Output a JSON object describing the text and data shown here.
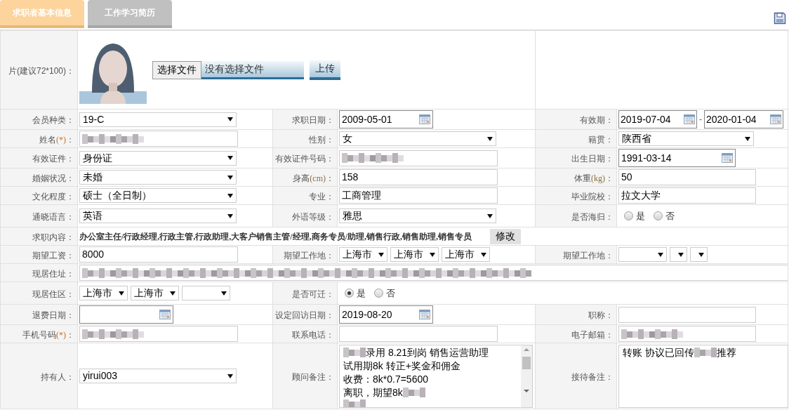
{
  "tabs": [
    {
      "label": "求职者基本信息",
      "selected": true
    },
    {
      "label": "工作学习简历",
      "selected": false
    }
  ],
  "photo_row": {
    "label": "片(建议72*100)：",
    "file_button": "选择文件",
    "file_status": "没有选择文件",
    "upload_button": "上传"
  },
  "rows": [
    {
      "cells": [
        {
          "label": "会员种类：",
          "field": {
            "kind": "select",
            "value": "19-C"
          }
        },
        {
          "label": "求职日期：",
          "field": {
            "kind": "date",
            "value": "2009-05-01"
          }
        },
        {
          "label": "有效期：",
          "field": {
            "kind": "date_range",
            "from": "2019-07-04",
            "separator": "-",
            "to": "2020-01-04"
          }
        }
      ]
    },
    {
      "cells": [
        {
          "label": "姓名",
          "mark": "(*)",
          "suffix": "：",
          "field": {
            "kind": "input",
            "blurred": true
          }
        },
        {
          "label": "性别：",
          "field": {
            "kind": "select",
            "value": "女"
          }
        },
        {
          "label": "籍贯：",
          "field": {
            "kind": "select",
            "value": "陕西省"
          }
        }
      ]
    },
    {
      "cells": [
        {
          "label": "有效证件：",
          "field": {
            "kind": "select",
            "value": "身份证"
          }
        },
        {
          "label": "有效证件号码：",
          "field": {
            "kind": "input",
            "blurred": true
          }
        },
        {
          "label": "出生日期：",
          "field": {
            "kind": "date",
            "value": "1991-03-14"
          }
        }
      ]
    },
    {
      "cells": [
        {
          "label": "婚姻状况：",
          "field": {
            "kind": "select",
            "value": "未婚"
          }
        },
        {
          "label": "身高",
          "unit": "(cm)",
          "suffix": "：",
          "field": {
            "kind": "input",
            "value": "158"
          }
        },
        {
          "label": "体重",
          "unit": "(kg)",
          "suffix": "：",
          "field": {
            "kind": "input",
            "value": "50"
          }
        }
      ]
    },
    {
      "cells": [
        {
          "label": "文化程度：",
          "field": {
            "kind": "select",
            "value": "硕士（全日制）"
          }
        },
        {
          "label": "专业：",
          "field": {
            "kind": "input",
            "value": "工商管理"
          }
        },
        {
          "label": "毕业院校：",
          "field": {
            "kind": "input",
            "value": "拉文大学"
          }
        }
      ]
    },
    {
      "cells": [
        {
          "label": "通晓语言：",
          "field": {
            "kind": "select",
            "value": "英语"
          }
        },
        {
          "label": "外语等级：",
          "field": {
            "kind": "select",
            "value": "雅思"
          }
        },
        {
          "label": "是否海归：",
          "field": {
            "kind": "radios",
            "options": [
              {
                "label": "是",
                "selected": false
              },
              {
                "label": "否",
                "selected": false
              }
            ]
          }
        }
      ]
    },
    {
      "cells": [
        {
          "label": "求职内容：",
          "field": {
            "kind": "summary",
            "text": "办公室主任/行政经理,行政主管,行政助理,大客户销售主管/经理,商务专员/助理,销售行政,销售助理,销售专员",
            "button": "修改"
          }
        }
      ]
    },
    {
      "cells": [
        {
          "label": "期望工资：",
          "field": {
            "kind": "input",
            "value": "8000"
          }
        },
        {
          "label": "期望工作地：",
          "field": {
            "kind": "selects",
            "items": [
              {
                "kind": "value",
                "value": "上海市"
              },
              {
                "kind": "value",
                "value": "上海市"
              },
              {
                "kind": "value",
                "value": "上海市"
              }
            ]
          }
        },
        {
          "label": "期望工作地：",
          "field": {
            "kind": "selects",
            "items": [
              {
                "kind": "blank"
              },
              {
                "kind": "blank"
              },
              {
                "kind": "blank"
              }
            ]
          }
        }
      ]
    },
    {
      "cells": [
        {
          "label": "现居住址：",
          "field": {
            "kind": "input",
            "blurred": true
          }
        }
      ]
    },
    {
      "cells": [
        {
          "label": "现居住区：",
          "field": {
            "kind": "selects",
            "items": [
              {
                "kind": "value",
                "value": "上海市"
              },
              {
                "kind": "value",
                "value": "上海市"
              },
              {
                "kind": "blank"
              }
            ]
          }
        },
        {
          "label": "是否可迁：",
          "field": {
            "kind": "radios",
            "options": [
              {
                "label": "是",
                "selected": true
              },
              {
                "label": "否",
                "selected": false
              }
            ]
          }
        }
      ]
    },
    {
      "cells": [
        {
          "label": "退费日期：",
          "field": {
            "kind": "date"
          }
        },
        {
          "label": "设定回访日期：",
          "field": {
            "kind": "date",
            "value": "2019-08-20"
          }
        },
        {
          "label": "职称：",
          "field": {
            "kind": "input"
          }
        }
      ]
    },
    {
      "cells": [
        {
          "label": "手机号码",
          "mark": "(*)",
          "suffix": "：",
          "field": {
            "kind": "input",
            "blurred": true
          }
        },
        {
          "label": "联系电话：",
          "field": {
            "kind": "input"
          }
        },
        {
          "label": "电子邮箱：",
          "field": {
            "kind": "input",
            "blurred": true
          }
        }
      ]
    },
    {
      "cells": [
        {
          "label": "持有人：",
          "field": {
            "kind": "select",
            "value": "yirui003"
          }
        },
        {
          "label": "顾问备注：",
          "field": {
            "kind": "textarea",
            "scrollable": true,
            "lines": [
              [
                {
                  "kind": "blur"
                },
                {
                  "kind": "text",
                  "text": "录用 8.21到岗 销售运营助理"
                }
              ],
              [
                {
                  "kind": "text",
                  "text": "试用期8k 转正+奖金和佣金"
                }
              ],
              [
                {
                  "kind": "text",
                  "text": "收费：8k*0.7=5600"
                }
              ],
              [
                {
                  "kind": "text",
                  "text": "离职，期望8k"
                },
                {
                  "kind": "blur"
                }
              ],
              [
                {
                  "kind": "blur"
                }
              ]
            ]
          }
        },
        {
          "label": "接待备注：",
          "field": {
            "kind": "textarea",
            "scrollable": false,
            "lines": [
              [
                {
                  "kind": "text",
                  "text": "转账 协议已回传"
                },
                {
                  "kind": "blur"
                },
                {
                  "kind": "text",
                  "text": "推荐"
                }
              ]
            ]
          }
        }
      ]
    }
  ]
}
